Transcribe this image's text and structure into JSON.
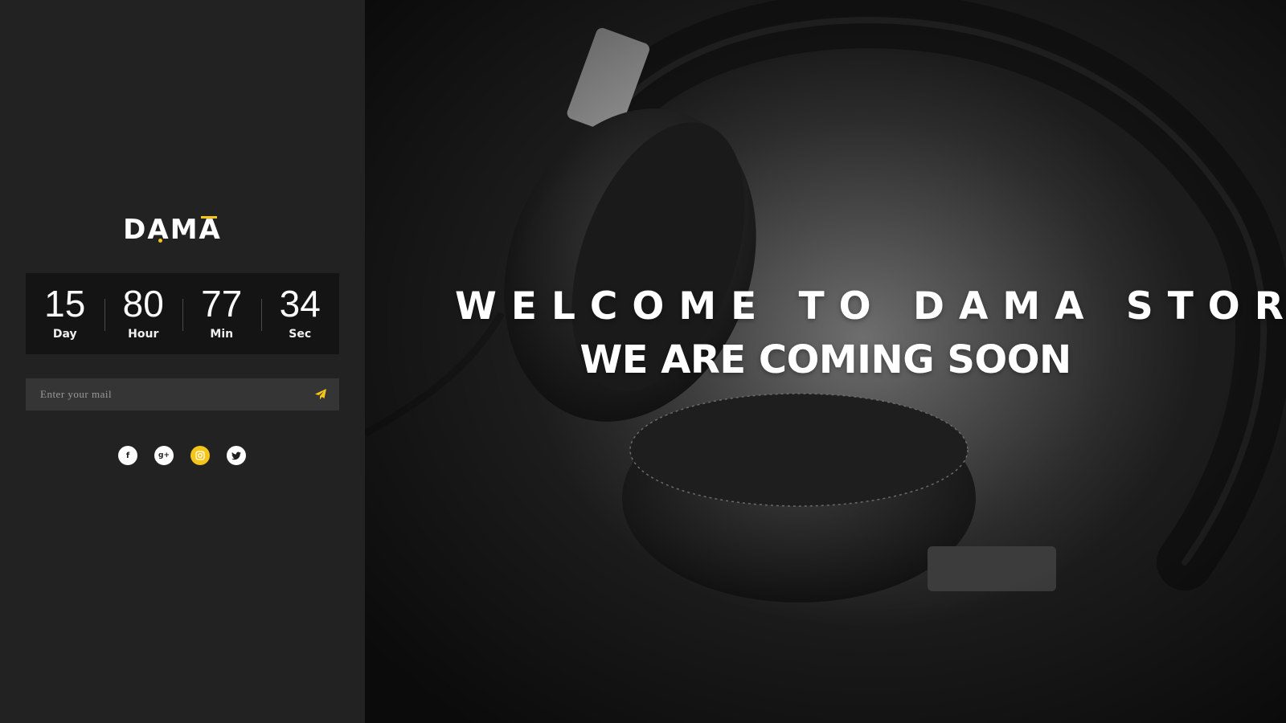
{
  "brand": {
    "name": "DAMA",
    "accent_color": "#f5c518"
  },
  "countdown": [
    {
      "value": "15",
      "label": "Day"
    },
    {
      "value": "80",
      "label": "Hour"
    },
    {
      "value": "77",
      "label": "Min"
    },
    {
      "value": "34",
      "label": "Sec"
    }
  ],
  "subscribe": {
    "placeholder": "Enter your mail",
    "send_icon": "paper-plane-icon"
  },
  "socials": [
    {
      "name": "facebook",
      "icon": "facebook-icon",
      "glyph": "f"
    },
    {
      "name": "google-plus",
      "icon": "google-plus-icon",
      "glyph": "g+"
    },
    {
      "name": "instagram",
      "icon": "instagram-icon",
      "glyph": "◎",
      "active": true
    },
    {
      "name": "twitter",
      "icon": "twitter-icon",
      "glyph": "🐦"
    }
  ],
  "hero": {
    "headline": "WELCOME TO DAMA STORE",
    "subheadline": "WE ARE COMING SOON",
    "background_image": "headphones-photo"
  }
}
